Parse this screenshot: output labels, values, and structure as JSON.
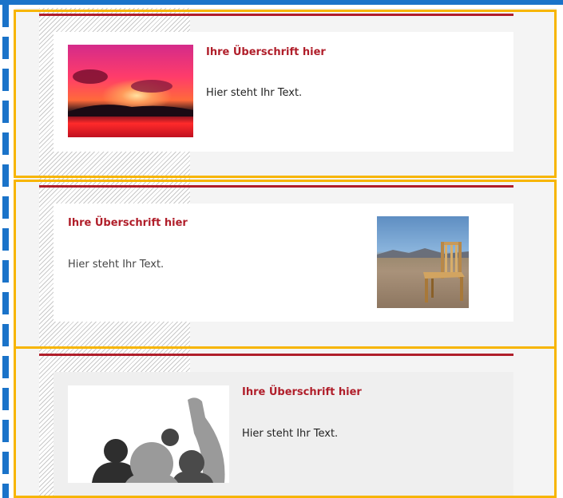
{
  "modules": [
    {
      "title": "Ihre Überschrift hier",
      "text": "Hier steht Ihr Text.",
      "image": "sunset-photo"
    },
    {
      "title": "Ihre Überschrift hier",
      "text": "Hier steht Ihr Text.",
      "image": "chair-in-desert-photo"
    },
    {
      "title": "Ihre Überschrift hier",
      "text": "Hier steht Ihr Text.",
      "image": "crowd-silhouette-graphic"
    }
  ],
  "colors": {
    "accent_red": "#b01e2a",
    "selection_yellow": "#f7b500",
    "guide_blue": "#1a73c9",
    "panel_grey": "#efefef"
  }
}
